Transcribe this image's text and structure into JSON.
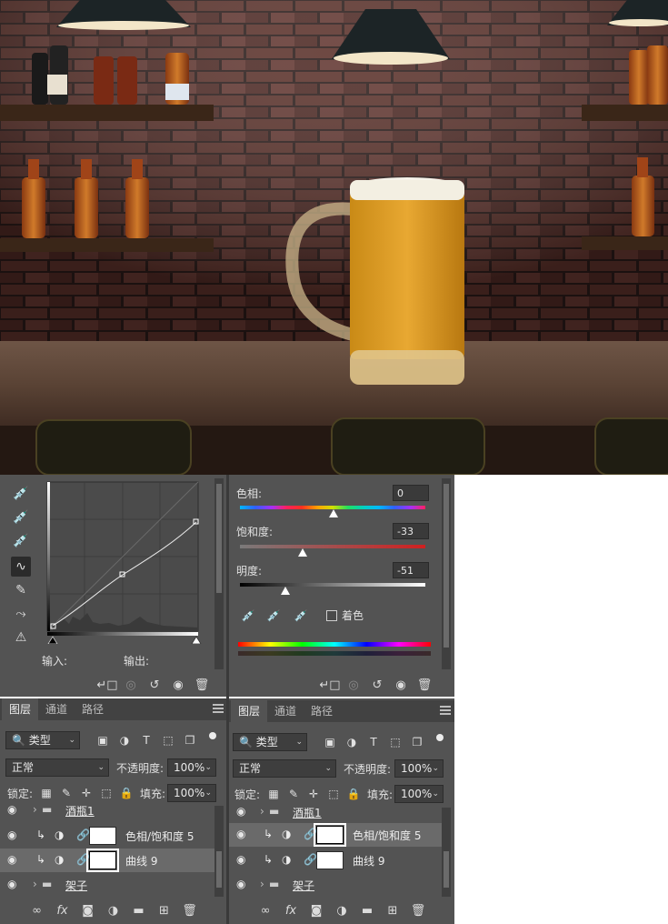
{
  "curves_panel": {
    "input_label": "输入:",
    "output_label": "输出:",
    "tools": [
      "eyedropper-black-icon",
      "eyedropper-gray-icon",
      "eyedropper-white-icon",
      "curve-point-icon",
      "pencil-icon",
      "smooth-icon",
      "histogram-warning-icon"
    ]
  },
  "hue_panel": {
    "hue_label": "色相:",
    "hue_value": "0",
    "saturation_label": "饱和度:",
    "saturation_value": "-33",
    "lightness_label": "明度:",
    "lightness_value": "-51",
    "colorize_label": "着色"
  },
  "layers_left": {
    "tabs": [
      "图层",
      "通道",
      "路径"
    ],
    "filter_label": "类型",
    "blend_mode": "正常",
    "opacity_label": "不透明度:",
    "opacity_value": "100%",
    "lock_label": "锁定:",
    "fill_label": "填充:",
    "fill_value": "100%",
    "layers": [
      {
        "name": "酒瓶1",
        "type": "group"
      },
      {
        "name": "色相/饱和度 5",
        "type": "adjustment"
      },
      {
        "name": "曲线 9",
        "type": "adjustment",
        "selected": true
      },
      {
        "name": "架子",
        "type": "group"
      }
    ]
  },
  "layers_right": {
    "tabs": [
      "图层",
      "通道",
      "路径"
    ],
    "filter_label": "类型",
    "blend_mode": "正常",
    "opacity_label": "不透明度:",
    "opacity_value": "100%",
    "lock_label": "锁定:",
    "fill_label": "填充:",
    "fill_value": "100%",
    "layers": [
      {
        "name": "酒瓶1",
        "type": "group"
      },
      {
        "name": "色相/饱和度 5",
        "type": "adjustment",
        "selected": true
      },
      {
        "name": "曲线 9",
        "type": "adjustment"
      },
      {
        "name": "架子",
        "type": "group"
      }
    ]
  },
  "colors": {
    "panel_bg": "#535353",
    "selected_row": "#6a6a6a"
  }
}
